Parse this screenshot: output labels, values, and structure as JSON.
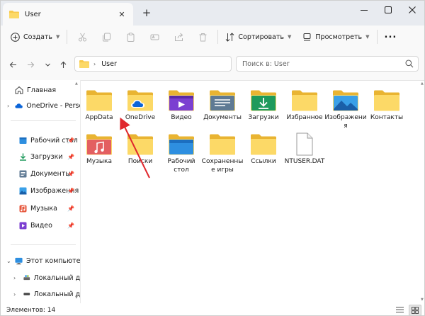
{
  "window": {
    "tab_title": "User",
    "colors": {
      "accent": "#0067c0",
      "folder": "#f7c94c",
      "arrow": "#e0282e"
    }
  },
  "commandbar": {
    "create_label": "Создать",
    "sort_label": "Сортировать",
    "view_label": "Просмотреть",
    "more_label": "..."
  },
  "addressbar": {
    "path": "User",
    "search_placeholder": "Поиск в: User"
  },
  "sidebar": {
    "home": "Главная",
    "onedrive": "OneDrive - Personal",
    "quick": [
      {
        "label": "Рабочий стол"
      },
      {
        "label": "Загрузки"
      },
      {
        "label": "Документы"
      },
      {
        "label": "Изображения"
      },
      {
        "label": "Музыка"
      },
      {
        "label": "Видео"
      }
    ],
    "this_pc": "Этот компьютер",
    "drives": [
      {
        "label": "Локальный диск"
      },
      {
        "label": "Локальный диск"
      }
    ]
  },
  "items": [
    {
      "label": "AppData",
      "icon": "folder-icon"
    },
    {
      "label": "OneDrive",
      "icon": "onedrive-folder-icon"
    },
    {
      "label": "Видео",
      "icon": "videos-folder-icon"
    },
    {
      "label": "Документы",
      "icon": "documents-folder-icon"
    },
    {
      "label": "Загрузки",
      "icon": "downloads-folder-icon"
    },
    {
      "label": "Избранное",
      "icon": "folder-icon"
    },
    {
      "label": "Изображения",
      "icon": "pictures-folder-icon"
    },
    {
      "label": "Контакты",
      "icon": "folder-icon"
    },
    {
      "label": "Музыка",
      "icon": "music-folder-icon"
    },
    {
      "label": "Поиски",
      "icon": "folder-icon"
    },
    {
      "label": "Рабочий стол",
      "icon": "desktop-folder-icon"
    },
    {
      "label": "Сохраненные игры",
      "icon": "folder-icon"
    },
    {
      "label": "Ссылки",
      "icon": "folder-icon"
    },
    {
      "label": "NTUSER.DAT",
      "icon": "file-icon"
    }
  ],
  "status": {
    "text": "Элементов: 14"
  }
}
